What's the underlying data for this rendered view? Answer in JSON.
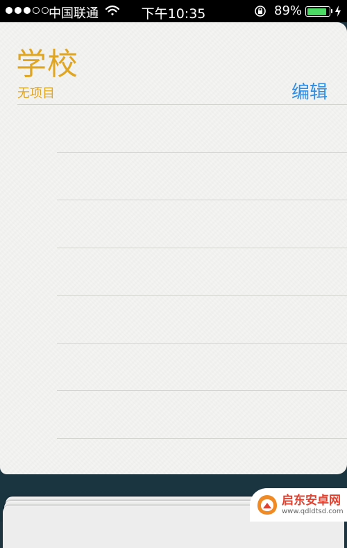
{
  "status_bar": {
    "carrier": "中国联通",
    "time": "下午10:35",
    "battery_percent": "89%",
    "battery_level": 0.89,
    "signal_bars": 3,
    "signal_total": 5
  },
  "list": {
    "title": "学校",
    "subtitle": "无项目",
    "edit_label": "编辑",
    "empty_row_count": 7
  },
  "colors": {
    "accent": "#e1a621",
    "link": "#2d8ee8",
    "battery": "#4cd964"
  },
  "watermark": {
    "name": "启东安卓网",
    "url": "www.qdldtsd.com"
  }
}
